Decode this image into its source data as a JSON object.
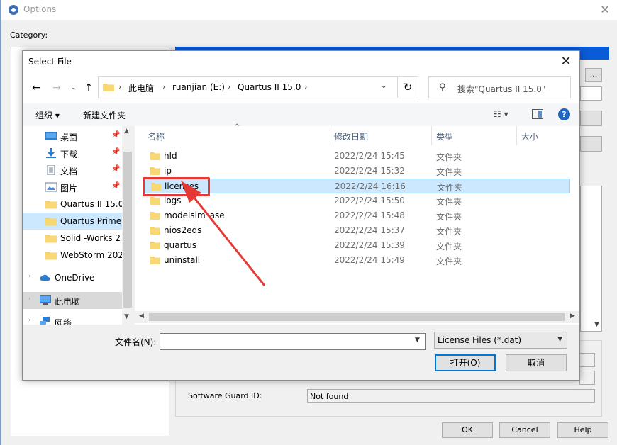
{
  "background_window": {
    "title": "Options",
    "category_label": "Category:",
    "dots_label": "...",
    "software_guard_label": "Software Guard ID:",
    "software_guard_value": "Not found",
    "buttons": {
      "ok": "OK",
      "cancel": "Cancel",
      "help": "Help"
    }
  },
  "dialog": {
    "title": "Select File",
    "address": {
      "items": [
        "此电脑",
        "ruanjian (E:)",
        "Quartus II 15.0"
      ]
    },
    "search_placeholder": "搜索\"Quartus II 15.0\"",
    "toolbar": {
      "organize": "组织 ▾",
      "new_folder": "新建文件夹"
    },
    "nav": {
      "items": [
        {
          "label": "桌面",
          "icon": "desktop-icon",
          "pinned": true
        },
        {
          "label": "下载",
          "icon": "download-icon",
          "pinned": true
        },
        {
          "label": "文档",
          "icon": "document-icon",
          "pinned": true
        },
        {
          "label": "图片",
          "icon": "picture-icon",
          "pinned": true
        },
        {
          "label": "Quartus II 15.0",
          "icon": "folder-icon",
          "pinned": false
        },
        {
          "label": "Quartus Prime",
          "icon": "folder-icon",
          "pinned": false
        },
        {
          "label": "Solid -Works 2",
          "icon": "folder-icon",
          "pinned": false
        },
        {
          "label": "WebStorm 202",
          "icon": "folder-icon",
          "pinned": false
        },
        {
          "label": "OneDrive",
          "icon": "cloud-icon",
          "pinned": false
        },
        {
          "label": "此电脑",
          "icon": "computer-icon",
          "pinned": false
        },
        {
          "label": "网络",
          "icon": "network-icon",
          "pinned": false
        }
      ]
    },
    "columns": {
      "name": "名称",
      "modified": "修改日期",
      "type": "类型",
      "size": "大小"
    },
    "files": [
      {
        "name": "hld",
        "modified": "2022/2/24 15:45",
        "type": "文件夹"
      },
      {
        "name": "ip",
        "modified": "2022/2/24 15:32",
        "type": "文件夹"
      },
      {
        "name": "licenses",
        "modified": "2022/2/24 16:16",
        "type": "文件夹"
      },
      {
        "name": "logs",
        "modified": "2022/2/24 15:50",
        "type": "文件夹"
      },
      {
        "name": "modelsim_ase",
        "modified": "2022/2/24 15:48",
        "type": "文件夹"
      },
      {
        "name": "nios2eds",
        "modified": "2022/2/24 15:37",
        "type": "文件夹"
      },
      {
        "name": "quartus",
        "modified": "2022/2/24 15:39",
        "type": "文件夹"
      },
      {
        "name": "uninstall",
        "modified": "2022/2/24 15:49",
        "type": "文件夹"
      }
    ],
    "filename_label": "文件名(N):",
    "filename_value": "",
    "filetype": "License Files (*.dat)",
    "open_button": "打开(O)",
    "cancel_button": "取消"
  },
  "colors": {
    "selection": "#cce8ff",
    "annotation_red": "#e53935",
    "accent_blue": "#0078d7",
    "folder_yellow": "#f5cf6a"
  }
}
